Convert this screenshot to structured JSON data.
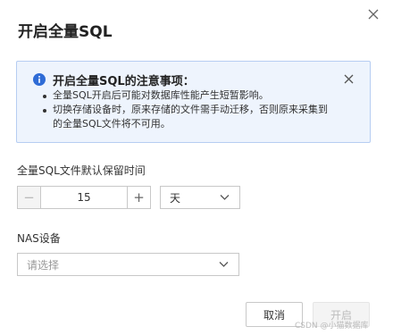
{
  "dialog": {
    "title": "开启全量SQL"
  },
  "notice": {
    "title": "开启全量SQL的注意事项：",
    "items": [
      "全量SQL开启后可能对数据库性能产生短暂影响。",
      "切换存储设备时，原来存储的文件需手动迁移，否则原来采集到的全量SQL文件将不可用。"
    ]
  },
  "retention": {
    "label": "全量SQL文件默认保留时间",
    "value": "15",
    "minus": "−",
    "plus": "+",
    "unit": "天"
  },
  "nas": {
    "label": "NAS设备",
    "placeholder": "请选择"
  },
  "footer": {
    "cancel_label": "取消",
    "ok_label": "开启"
  },
  "watermark": "CSDN @小猫数据库",
  "colors": {
    "notice_bg": "#eef4fd",
    "notice_border": "#b6cdf2",
    "info_icon": "#2f6cd6",
    "disabled_text": "#bdbdbd"
  },
  "icons": {
    "dialog_close": "close-icon",
    "notice_info": "info-icon",
    "notice_close": "close-icon",
    "select_arrow": "chevron-down-icon"
  }
}
